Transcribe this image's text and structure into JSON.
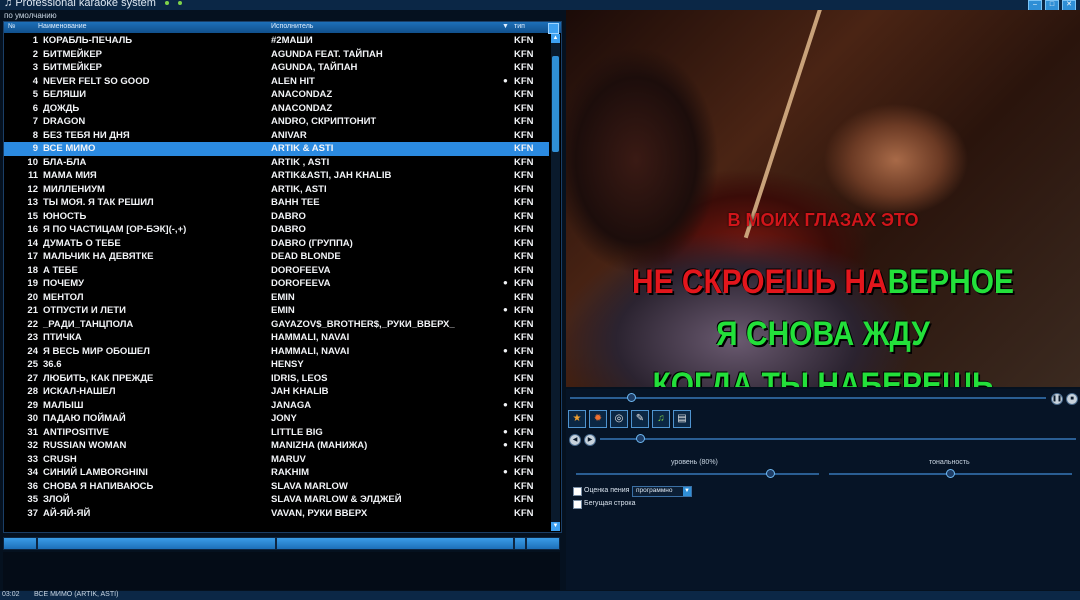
{
  "app": {
    "title": "Professional karaoke system",
    "sort_line": "по умолчанию",
    "dot_colors": [
      "#7fd24a",
      "#7fd24a"
    ]
  },
  "list": {
    "headers": {
      "num": "№",
      "title": "Наименование",
      "artist": "Исполнитель",
      "type": "тип"
    },
    "rows": [
      {
        "num": "1",
        "title": "КОРАБЛЬ-ПЕЧАЛЬ",
        "artist": "#2МАШИ",
        "dot": "",
        "type": "KFN"
      },
      {
        "num": "2",
        "title": "БИТМЕЙКЕР",
        "artist": "AGUNDA FEAT. ТАЙПАН",
        "dot": "",
        "type": "KFN"
      },
      {
        "num": "3",
        "title": "БИТМЕЙКЕР",
        "artist": "AGUNDA, ТАЙПАН",
        "dot": "",
        "type": "KFN"
      },
      {
        "num": "4",
        "title": "NEVER FELT SO GOOD",
        "artist": "ALEN HIT",
        "dot": "●",
        "type": "KFN"
      },
      {
        "num": "5",
        "title": "БЕЛЯШИ",
        "artist": "ANACONDAZ",
        "dot": "",
        "type": "KFN"
      },
      {
        "num": "6",
        "title": "ДОЖДЬ",
        "artist": "ANACONDAZ",
        "dot": "",
        "type": "KFN"
      },
      {
        "num": "7",
        "title": "DRAGON",
        "artist": "ANDRO, СКРИПТОНИТ",
        "dot": "",
        "type": "KFN"
      },
      {
        "num": "8",
        "title": "БЕЗ ТЕБЯ НИ ДНЯ",
        "artist": "ANIVAR",
        "dot": "",
        "type": "KFN"
      },
      {
        "num": "9",
        "title": "ВСЕ МИМО",
        "artist": "ARTIK & ASTI",
        "dot": "",
        "type": "KFN"
      },
      {
        "num": "10",
        "title": "БЛА-БЛА",
        "artist": "ARTIK , ASTI",
        "dot": "",
        "type": "KFN"
      },
      {
        "num": "11",
        "title": "МАМА МИЯ",
        "artist": "ARTIK&ASTI, JAH KHALIB",
        "dot": "",
        "type": "KFN"
      },
      {
        "num": "12",
        "title": "МИЛЛЕНИУМ",
        "artist": "ARTIK, ASTI",
        "dot": "",
        "type": "KFN"
      },
      {
        "num": "13",
        "title": "ТЫ МОЯ. Я ТАК РЕШИЛ",
        "artist": "BAHH TEE",
        "dot": "",
        "type": "KFN"
      },
      {
        "num": "15",
        "title": "ЮНОСТЬ",
        "artist": "DABRO",
        "dot": "",
        "type": "KFN"
      },
      {
        "num": "16",
        "title": "Я ПО ЧАСТИЦАМ [OP-БЭК](-,+)",
        "artist": "DABRO",
        "dot": "",
        "type": "KFN"
      },
      {
        "num": "14",
        "title": "ДУМАТЬ О ТЕБЕ",
        "artist": "DABRO (ГРУППА)",
        "dot": "",
        "type": "KFN"
      },
      {
        "num": "17",
        "title": "МАЛЬЧИК НА ДЕВЯТКЕ",
        "artist": "DEAD BLONDE",
        "dot": "",
        "type": "KFN"
      },
      {
        "num": "18",
        "title": "А ТЕБЕ",
        "artist": "DOROFEEVA",
        "dot": "",
        "type": "KFN"
      },
      {
        "num": "19",
        "title": "ПОЧЕМУ",
        "artist": "DOROFEEVA",
        "dot": "●",
        "type": "KFN"
      },
      {
        "num": "20",
        "title": "МЕНТОЛ",
        "artist": "EMIN",
        "dot": "",
        "type": "KFN"
      },
      {
        "num": "21",
        "title": "ОТПУСТИ И ЛЕТИ",
        "artist": "EMIN",
        "dot": "●",
        "type": "KFN"
      },
      {
        "num": "22",
        "title": "_РАДИ_ТАНЦПОЛА",
        "artist": "GAYAZOV$_BROTHER$,_РУКИ_ВВЕРХ_",
        "dot": "",
        "type": "KFN"
      },
      {
        "num": "23",
        "title": "ПТИЧКА",
        "artist": "HAMMALI, NAVAI",
        "dot": "",
        "type": "KFN"
      },
      {
        "num": "24",
        "title": "Я ВЕСЬ МИР ОБОШЕЛ",
        "artist": "HAMMALI, NAVAI",
        "dot": "●",
        "type": "KFN"
      },
      {
        "num": "25",
        "title": "36.6",
        "artist": "HENSY",
        "dot": "",
        "type": "KFN"
      },
      {
        "num": "27",
        "title": "ЛЮБИТЬ, КАК ПРЕЖДЕ",
        "artist": "IDRIS, LEOS",
        "dot": "",
        "type": "KFN"
      },
      {
        "num": "28",
        "title": "ИСКАЛ-НАШЕЛ",
        "artist": "JAH KHALIB",
        "dot": "",
        "type": "KFN"
      },
      {
        "num": "29",
        "title": "МАЛЫШ",
        "artist": "JANAGA",
        "dot": "●",
        "type": "KFN"
      },
      {
        "num": "30",
        "title": "ПАДАЮ ПОЙМАЙ",
        "artist": "JONY",
        "dot": "",
        "type": "KFN"
      },
      {
        "num": "31",
        "title": "ANTIPOSITIVE",
        "artist": "LITTLE BIG",
        "dot": "●",
        "type": "KFN"
      },
      {
        "num": "32",
        "title": "RUSSIAN WOMAN",
        "artist": "MANIZHA (МАНИЖА)",
        "dot": "●",
        "type": "KFN"
      },
      {
        "num": "33",
        "title": "CRUSH",
        "artist": "MARUV",
        "dot": "",
        "type": "KFN"
      },
      {
        "num": "34",
        "title": "СИНИЙ LAMBORGHINI",
        "artist": "RAKHIM",
        "dot": "●",
        "type": "KFN"
      },
      {
        "num": "36",
        "title": "СНОВА Я НАПИВАЮСЬ",
        "artist": "SLAVA MARLOW",
        "dot": "",
        "type": "KFN"
      },
      {
        "num": "35",
        "title": "ЗЛОЙ",
        "artist": "SLAVA MARLOW & ЭЛДЖЕЙ",
        "dot": "",
        "type": "KFN"
      },
      {
        "num": "37",
        "title": "АЙ-ЯЙ-ЯЙ",
        "artist": "VAVAN, РУКИ ВВЕРХ",
        "dot": "",
        "type": "KFN"
      }
    ],
    "selected_num": "9"
  },
  "lyrics": {
    "line1": "В МОИХ ГЛАЗАХ ЭТО",
    "line2_sung": "НЕ СКРОЕШЬ НА",
    "line2_rest": "ВЕРНОЕ",
    "line3": "Я СНОВА ЖДУ",
    "line4": "КОГДА ТЫ НАБЕРЕШЬ"
  },
  "controls": {
    "volume_label": "уровень (80%)",
    "volume_level": 0.8,
    "key_label": "тональность",
    "score_label": "Оценка пения",
    "score_select": "программно",
    "ticker_label": "Бегущая строка",
    "tools": [
      "star-icon",
      "gear-icon",
      "search-icon",
      "pen-icon",
      "music-icon",
      "note-icon"
    ]
  },
  "status": {
    "time": "03:02",
    "now_playing": "ВСЕ МИМО (ARTIK, ASTI)"
  }
}
